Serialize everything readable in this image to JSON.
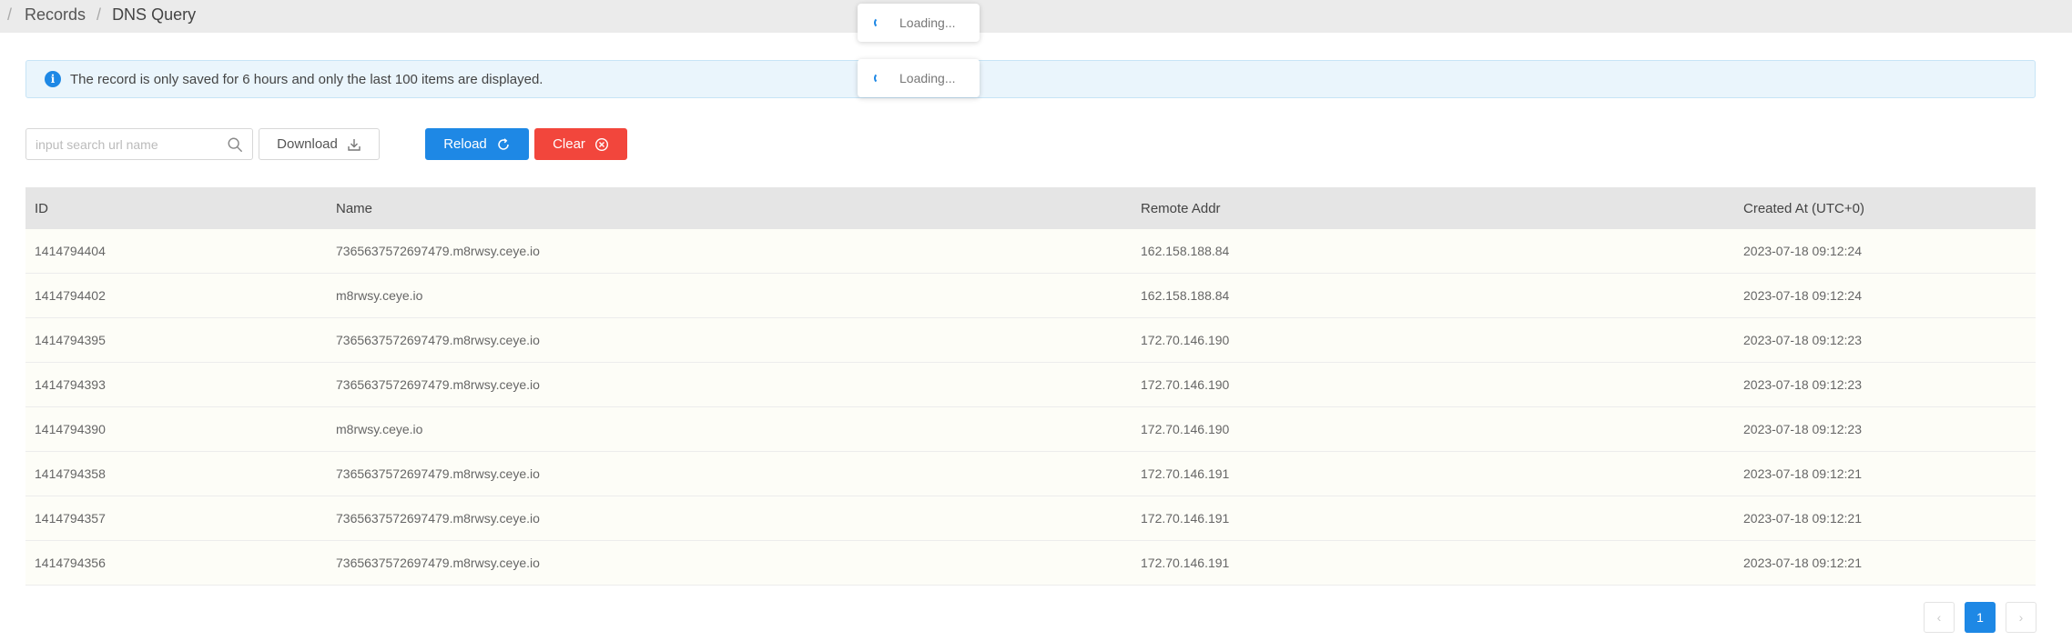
{
  "breadcrumb": {
    "separator": "/",
    "items": [
      "Records",
      "DNS Query"
    ]
  },
  "alert": {
    "icon": "info-icon",
    "text": "The record is only saved for 6 hours and only the last 100 items are displayed."
  },
  "toasts": [
    {
      "text": "Loading..."
    },
    {
      "text": "Loading..."
    }
  ],
  "toolbar": {
    "search_placeholder": "input search url name",
    "download_label": "Download",
    "reload_label": "Reload",
    "clear_label": "Clear"
  },
  "table": {
    "columns": [
      "ID",
      "Name",
      "Remote Addr",
      "Created At (UTC+0)"
    ],
    "rows": [
      [
        "1414794404",
        "7365637572697479.m8rwsy.ceye.io",
        "162.158.188.84",
        "2023-07-18 09:12:24"
      ],
      [
        "1414794402",
        "m8rwsy.ceye.io",
        "162.158.188.84",
        "2023-07-18 09:12:24"
      ],
      [
        "1414794395",
        "7365637572697479.m8rwsy.ceye.io",
        "172.70.146.190",
        "2023-07-18 09:12:23"
      ],
      [
        "1414794393",
        "7365637572697479.m8rwsy.ceye.io",
        "172.70.146.190",
        "2023-07-18 09:12:23"
      ],
      [
        "1414794390",
        "m8rwsy.ceye.io",
        "172.70.146.190",
        "2023-07-18 09:12:23"
      ],
      [
        "1414794358",
        "7365637572697479.m8rwsy.ceye.io",
        "172.70.146.191",
        "2023-07-18 09:12:21"
      ],
      [
        "1414794357",
        "7365637572697479.m8rwsy.ceye.io",
        "172.70.146.191",
        "2023-07-18 09:12:21"
      ],
      [
        "1414794356",
        "7365637572697479.m8rwsy.ceye.io",
        "172.70.146.191",
        "2023-07-18 09:12:21"
      ]
    ]
  },
  "pagination": {
    "prev": "‹",
    "current": "1",
    "next": "›"
  },
  "colors": {
    "primary": "#1e88e5",
    "danger": "#f2463c",
    "alert_bg": "#eaf5fc",
    "header_bg": "#e5e5e5"
  }
}
